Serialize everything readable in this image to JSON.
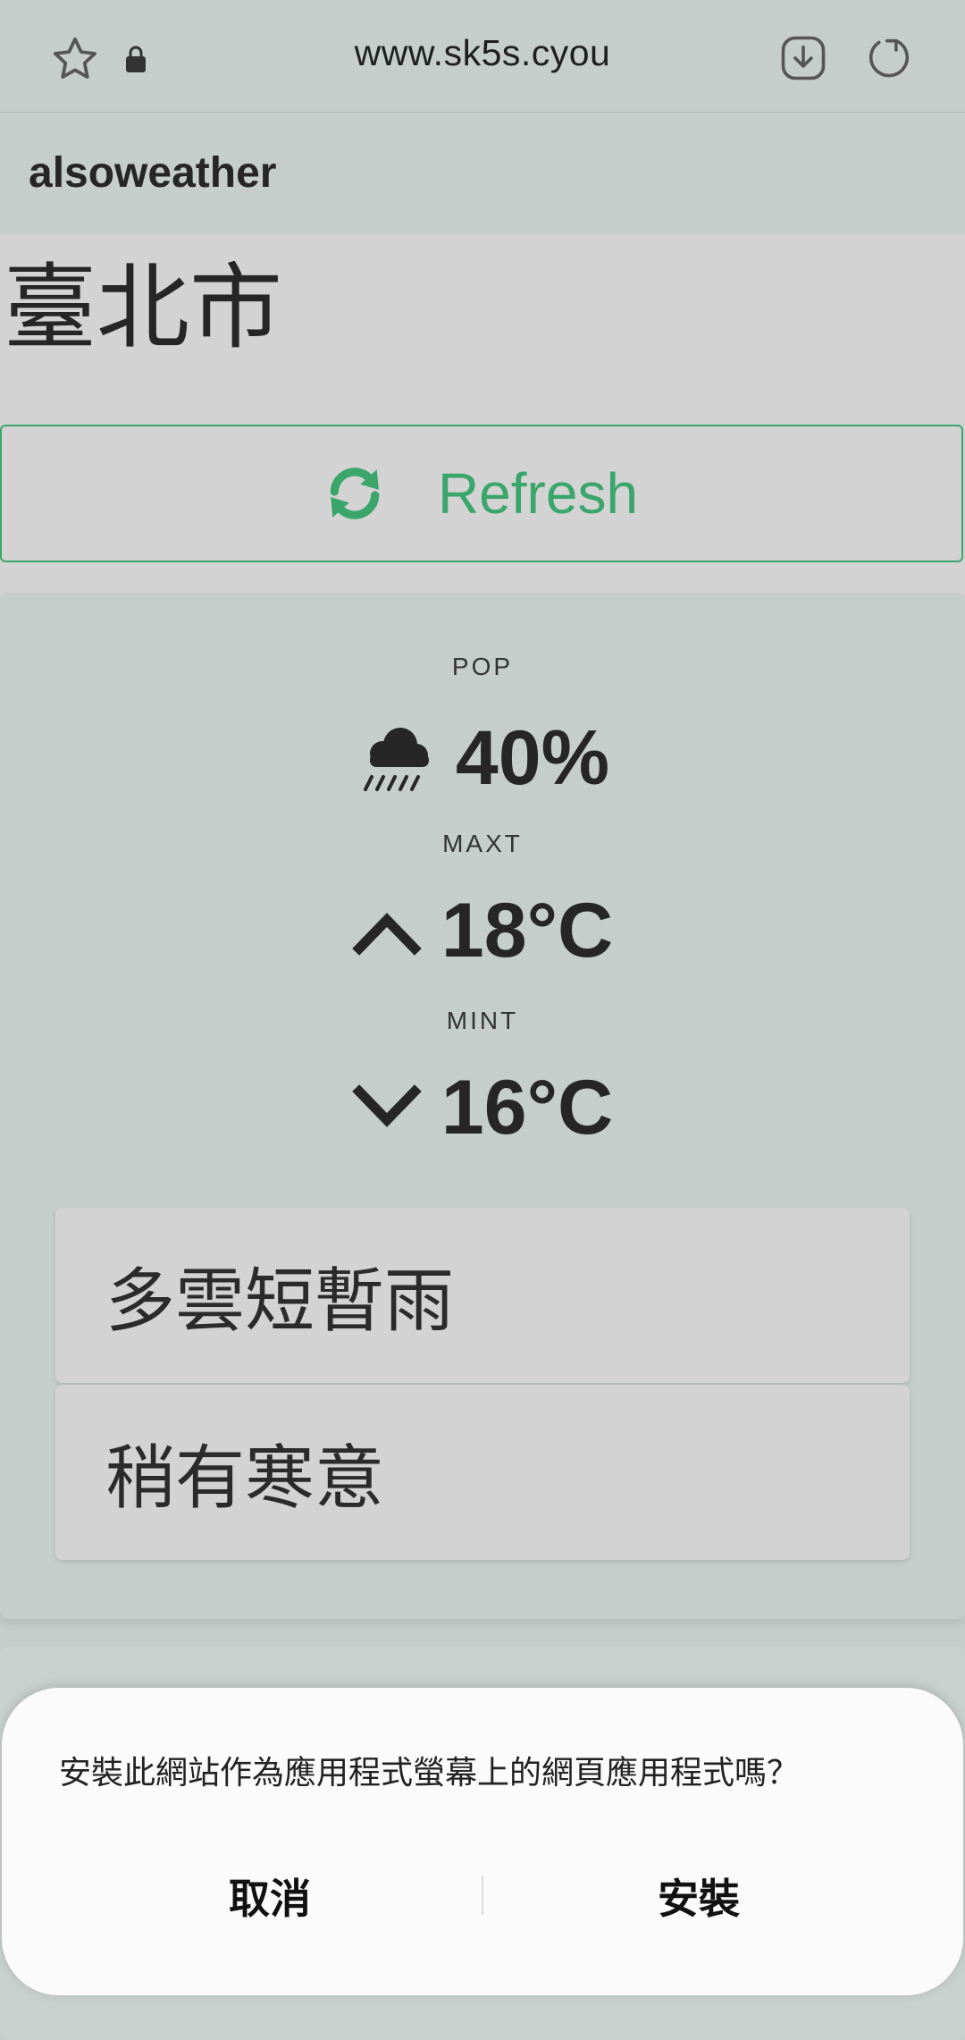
{
  "browser": {
    "url": "www.sk5s.cyou",
    "icons": [
      "star-icon",
      "lock-icon",
      "download-icon",
      "reload-icon"
    ]
  },
  "app": {
    "title": "alsoweather"
  },
  "location": {
    "city": "臺北市"
  },
  "refresh": {
    "label": "Refresh",
    "icon": "refresh-icon"
  },
  "weather": {
    "pop": {
      "label": "POP",
      "value": "40%",
      "icon": "cloud-rain-icon"
    },
    "maxt": {
      "label": "MAXT",
      "value": "18°C",
      "icon": "chevron-up-icon"
    },
    "mint": {
      "label": "MINT",
      "value": "16°C",
      "icon": "chevron-down-icon"
    },
    "descriptions": [
      "多雲短暫雨",
      "稍有寒意"
    ]
  },
  "install_dialog": {
    "message": "安裝此網站作為應用程式螢幕上的網頁應用程式嗎？",
    "cancel_label": "取消",
    "install_label": "安裝"
  },
  "colors": {
    "background": "#c5cecb",
    "accent_green": "#3aa66c",
    "card_gray": "#d3d3d3",
    "dialog_bg": "#fbfbfb"
  }
}
